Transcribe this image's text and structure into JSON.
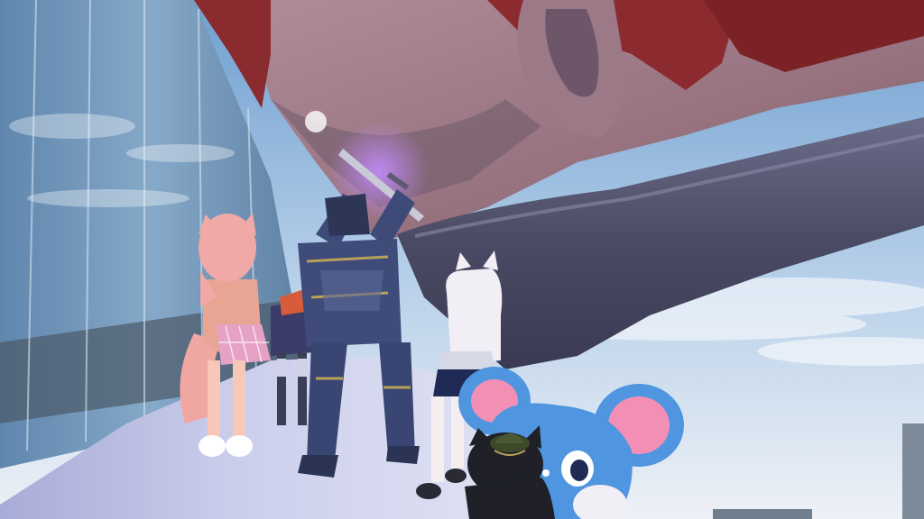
{
  "scene": {
    "kind": "vr-social-world-screenshot",
    "hud_text": [],
    "palette": {
      "sky_top": "#6f9fd0",
      "sky_bottom": "#e9eef6",
      "skin": "#a48289",
      "skin_shadow": "#6e5a6b",
      "hair_red": "#8a2b2f",
      "arm_dark": "#4b4b66",
      "glass": "#6f94b8",
      "walkway": "#c7cbe8",
      "armor": "#3e4a78",
      "armor_gold": "#b8a25a",
      "fox_pink": "#f0a7a2",
      "cat_white": "#f2eef5",
      "mouse_blue": "#4f95e0",
      "mouse_pink": "#f38fb5",
      "black_cat": "#1f2028"
    },
    "avatars": [
      {
        "id": "fox-girl",
        "icon": "fox-avatar"
      },
      {
        "id": "dark-girl",
        "icon": "dark-dress-avatar"
      },
      {
        "id": "armored-knight",
        "icon": "knight-avatar"
      },
      {
        "id": "white-cat-girl",
        "icon": "cat-girl-avatar"
      },
      {
        "id": "blue-mouse",
        "icon": "mouse-mascot"
      },
      {
        "id": "black-cat",
        "icon": "black-cat-avatar"
      }
    ]
  }
}
